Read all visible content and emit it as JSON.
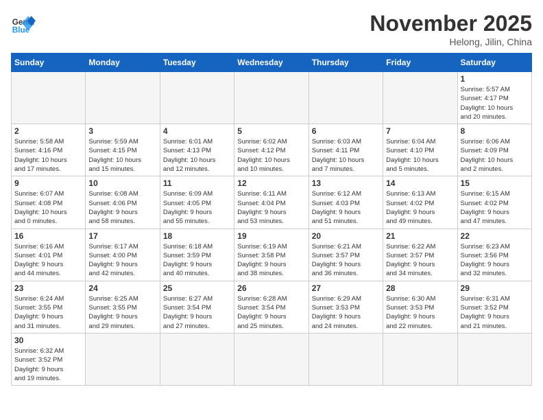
{
  "header": {
    "logo_general": "General",
    "logo_blue": "Blue",
    "month_title": "November 2025",
    "location": "Helong, Jilin, China"
  },
  "days_of_week": [
    "Sunday",
    "Monday",
    "Tuesday",
    "Wednesday",
    "Thursday",
    "Friday",
    "Saturday"
  ],
  "weeks": [
    [
      {
        "day": null,
        "info": ""
      },
      {
        "day": null,
        "info": ""
      },
      {
        "day": null,
        "info": ""
      },
      {
        "day": null,
        "info": ""
      },
      {
        "day": null,
        "info": ""
      },
      {
        "day": null,
        "info": ""
      },
      {
        "day": "1",
        "info": "Sunrise: 5:57 AM\nSunset: 4:17 PM\nDaylight: 10 hours\nand 20 minutes."
      }
    ],
    [
      {
        "day": "2",
        "info": "Sunrise: 5:58 AM\nSunset: 4:16 PM\nDaylight: 10 hours\nand 17 minutes."
      },
      {
        "day": "3",
        "info": "Sunrise: 5:59 AM\nSunset: 4:15 PM\nDaylight: 10 hours\nand 15 minutes."
      },
      {
        "day": "4",
        "info": "Sunrise: 6:01 AM\nSunset: 4:13 PM\nDaylight: 10 hours\nand 12 minutes."
      },
      {
        "day": "5",
        "info": "Sunrise: 6:02 AM\nSunset: 4:12 PM\nDaylight: 10 hours\nand 10 minutes."
      },
      {
        "day": "6",
        "info": "Sunrise: 6:03 AM\nSunset: 4:11 PM\nDaylight: 10 hours\nand 7 minutes."
      },
      {
        "day": "7",
        "info": "Sunrise: 6:04 AM\nSunset: 4:10 PM\nDaylight: 10 hours\nand 5 minutes."
      },
      {
        "day": "8",
        "info": "Sunrise: 6:06 AM\nSunset: 4:09 PM\nDaylight: 10 hours\nand 2 minutes."
      }
    ],
    [
      {
        "day": "9",
        "info": "Sunrise: 6:07 AM\nSunset: 4:08 PM\nDaylight: 10 hours\nand 0 minutes."
      },
      {
        "day": "10",
        "info": "Sunrise: 6:08 AM\nSunset: 4:06 PM\nDaylight: 9 hours\nand 58 minutes."
      },
      {
        "day": "11",
        "info": "Sunrise: 6:09 AM\nSunset: 4:05 PM\nDaylight: 9 hours\nand 55 minutes."
      },
      {
        "day": "12",
        "info": "Sunrise: 6:11 AM\nSunset: 4:04 PM\nDaylight: 9 hours\nand 53 minutes."
      },
      {
        "day": "13",
        "info": "Sunrise: 6:12 AM\nSunset: 4:03 PM\nDaylight: 9 hours\nand 51 minutes."
      },
      {
        "day": "14",
        "info": "Sunrise: 6:13 AM\nSunset: 4:02 PM\nDaylight: 9 hours\nand 49 minutes."
      },
      {
        "day": "15",
        "info": "Sunrise: 6:15 AM\nSunset: 4:02 PM\nDaylight: 9 hours\nand 47 minutes."
      }
    ],
    [
      {
        "day": "16",
        "info": "Sunrise: 6:16 AM\nSunset: 4:01 PM\nDaylight: 9 hours\nand 44 minutes."
      },
      {
        "day": "17",
        "info": "Sunrise: 6:17 AM\nSunset: 4:00 PM\nDaylight: 9 hours\nand 42 minutes."
      },
      {
        "day": "18",
        "info": "Sunrise: 6:18 AM\nSunset: 3:59 PM\nDaylight: 9 hours\nand 40 minutes."
      },
      {
        "day": "19",
        "info": "Sunrise: 6:19 AM\nSunset: 3:58 PM\nDaylight: 9 hours\nand 38 minutes."
      },
      {
        "day": "20",
        "info": "Sunrise: 6:21 AM\nSunset: 3:57 PM\nDaylight: 9 hours\nand 36 minutes."
      },
      {
        "day": "21",
        "info": "Sunrise: 6:22 AM\nSunset: 3:57 PM\nDaylight: 9 hours\nand 34 minutes."
      },
      {
        "day": "22",
        "info": "Sunrise: 6:23 AM\nSunset: 3:56 PM\nDaylight: 9 hours\nand 32 minutes."
      }
    ],
    [
      {
        "day": "23",
        "info": "Sunrise: 6:24 AM\nSunset: 3:55 PM\nDaylight: 9 hours\nand 31 minutes."
      },
      {
        "day": "24",
        "info": "Sunrise: 6:25 AM\nSunset: 3:55 PM\nDaylight: 9 hours\nand 29 minutes."
      },
      {
        "day": "25",
        "info": "Sunrise: 6:27 AM\nSunset: 3:54 PM\nDaylight: 9 hours\nand 27 minutes."
      },
      {
        "day": "26",
        "info": "Sunrise: 6:28 AM\nSunset: 3:54 PM\nDaylight: 9 hours\nand 25 minutes."
      },
      {
        "day": "27",
        "info": "Sunrise: 6:29 AM\nSunset: 3:53 PM\nDaylight: 9 hours\nand 24 minutes."
      },
      {
        "day": "28",
        "info": "Sunrise: 6:30 AM\nSunset: 3:53 PM\nDaylight: 9 hours\nand 22 minutes."
      },
      {
        "day": "29",
        "info": "Sunrise: 6:31 AM\nSunset: 3:52 PM\nDaylight: 9 hours\nand 21 minutes."
      }
    ],
    [
      {
        "day": "30",
        "info": "Sunrise: 6:32 AM\nSunset: 3:52 PM\nDaylight: 9 hours\nand 19 minutes."
      },
      {
        "day": null,
        "info": ""
      },
      {
        "day": null,
        "info": ""
      },
      {
        "day": null,
        "info": ""
      },
      {
        "day": null,
        "info": ""
      },
      {
        "day": null,
        "info": ""
      },
      {
        "day": null,
        "info": ""
      }
    ]
  ]
}
